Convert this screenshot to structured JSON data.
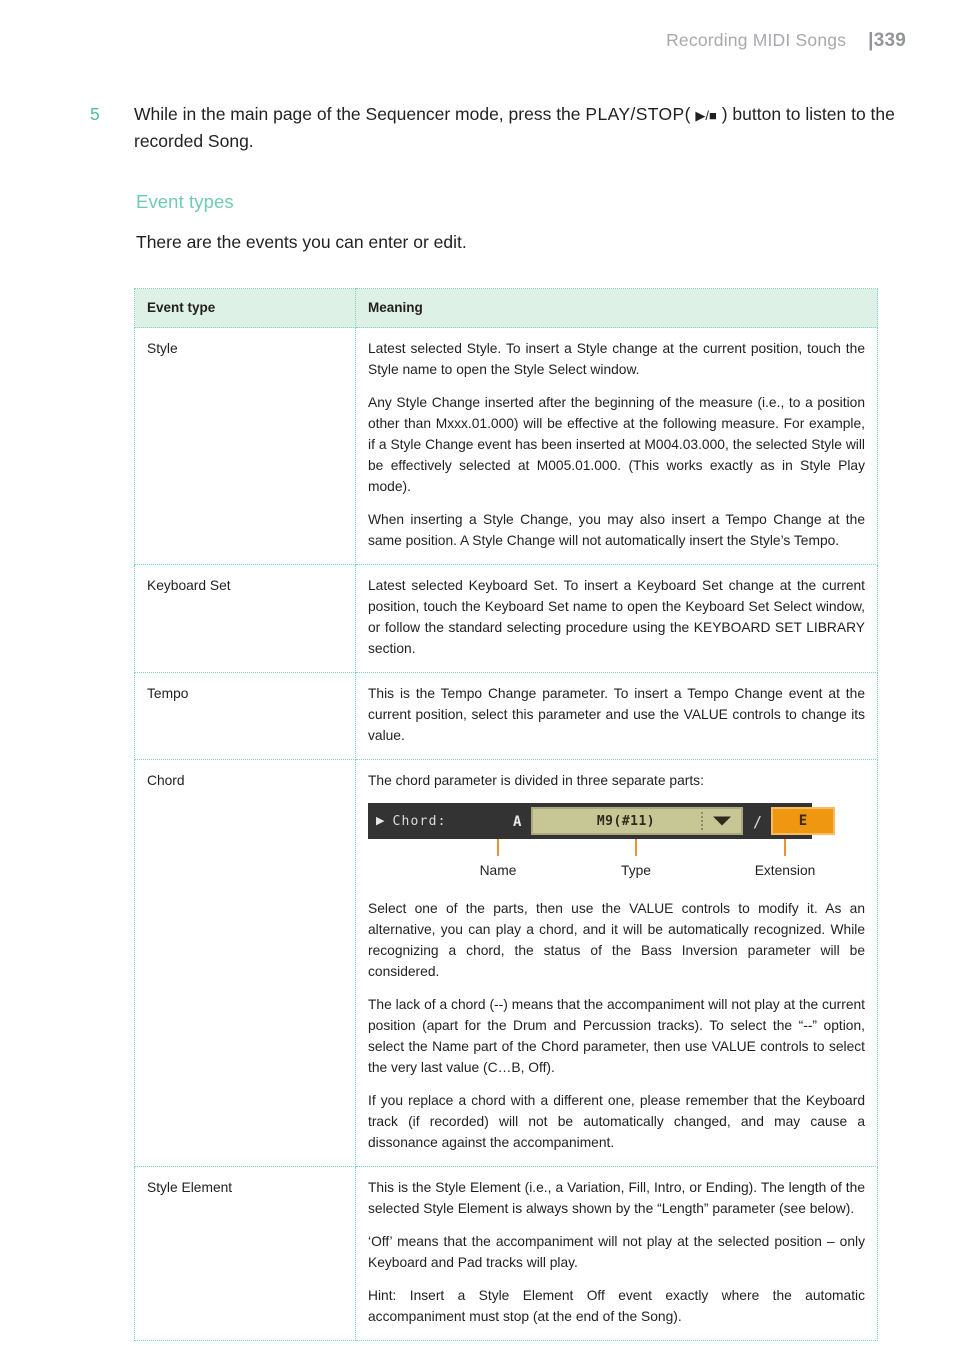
{
  "header": {
    "title": "Recording MIDI Songs",
    "page_number": "339",
    "separator": "|"
  },
  "step": {
    "number": "5",
    "text_before": "While in the main page of the Sequencer mode, press the ",
    "kbd": "PLAY/STOP",
    "paren_open": "( ",
    "glyph_play": "▶",
    "glyph_sep": "/",
    "glyph_stop": "■",
    "paren_close": " )",
    "text_after": " button to listen to the recorded Song."
  },
  "section": {
    "heading": "Event types",
    "intro": "There are the events you can enter or edit."
  },
  "table": {
    "columns": [
      "Event type",
      "Meaning"
    ],
    "rows": [
      {
        "type": "Style",
        "paragraphs": [
          "Latest selected Style. To insert a Style change at the current posi­tion, touch the Style name to open the Style Select window.",
          "Any Style Change inserted after the beginning of the measure (i.e., to a position other than Mxxx.01.000) will be effective at the follow­ing measure. For example, if a Style Change event has been inserted at M004.03.000, the selected Style will be effectively selected at M005.01.000. (This works exactly as in Style Play mode).",
          "When inserting a Style Change, you may also insert a Tempo Change at the same position. A Style Change will not automatically insert the Style’s Tempo."
        ]
      },
      {
        "type": "Keyboard Set",
        "paragraphs": [
          "Latest selected Keyboard Set. To insert a Keyboard Set change at the current position, touch the Keyboard Set name to open the Keyboard Set Select window, or follow the standard selecting procedure using the KEYBOARD SET LIBRARY section."
        ]
      },
      {
        "type": "Tempo",
        "paragraphs": [
          "This is the Tempo Change parameter. To insert a Tempo Change event at the current position, select this parameter and use the VALUE controls to change its value."
        ]
      },
      {
        "type": "Chord",
        "intro_paragraph": "The chord parameter is divided in three separate parts:",
        "figure": {
          "arrow_glyph": "▶",
          "label": "Chord:",
          "name_value": "A",
          "type_value": "M9(#11)",
          "slash": "/",
          "extension_value": "E",
          "callouts": [
            "Name",
            "Type",
            "Extension"
          ]
        },
        "paragraphs": [
          "Select one of the parts, then use the VALUE controls to modify it. As an alternative, you can play a chord, and it will be automatically rec­ognized. While recognizing a chord, the status of the Bass Inversion parameter will be considered.",
          "The lack of a chord (--) means that the accompaniment will not play at the current position (apart for the Drum and Percussion tracks). To select the “--” option, select the Name part of the Chord parame­ter, then use VALUE controls to select the very last value (C…B, Off).",
          "If you replace a chord with a different one, please remember that the Keyboard track (if recorded) will not be automatically changed, and may cause a dissonance against the accompaniment."
        ]
      },
      {
        "type": "Style Element",
        "paragraphs": [
          "This is the Style Element (i.e., a Variation, Fill, Intro, or Ending). The length of the selected Style Element is always shown by the “Length” parameter (see below).",
          "‘Off’ means that the accompaniment will not play at the selected po­sition – only Keyboard and Pad tracks will play.",
          "Hint: Insert a Style Element Off event exactly where the automatic accompaniment must stop (at the end of the Song)."
        ]
      }
    ]
  },
  "colors": {
    "accent_green": "#6fccb0",
    "header_row_bg": "#ddf1e7",
    "border_dotted": "#7fd2bb",
    "callout_orange": "#ef8f3c",
    "device_bg": "#333333",
    "field_khaki": "#c7c795",
    "extension_orange": "#f09712"
  }
}
